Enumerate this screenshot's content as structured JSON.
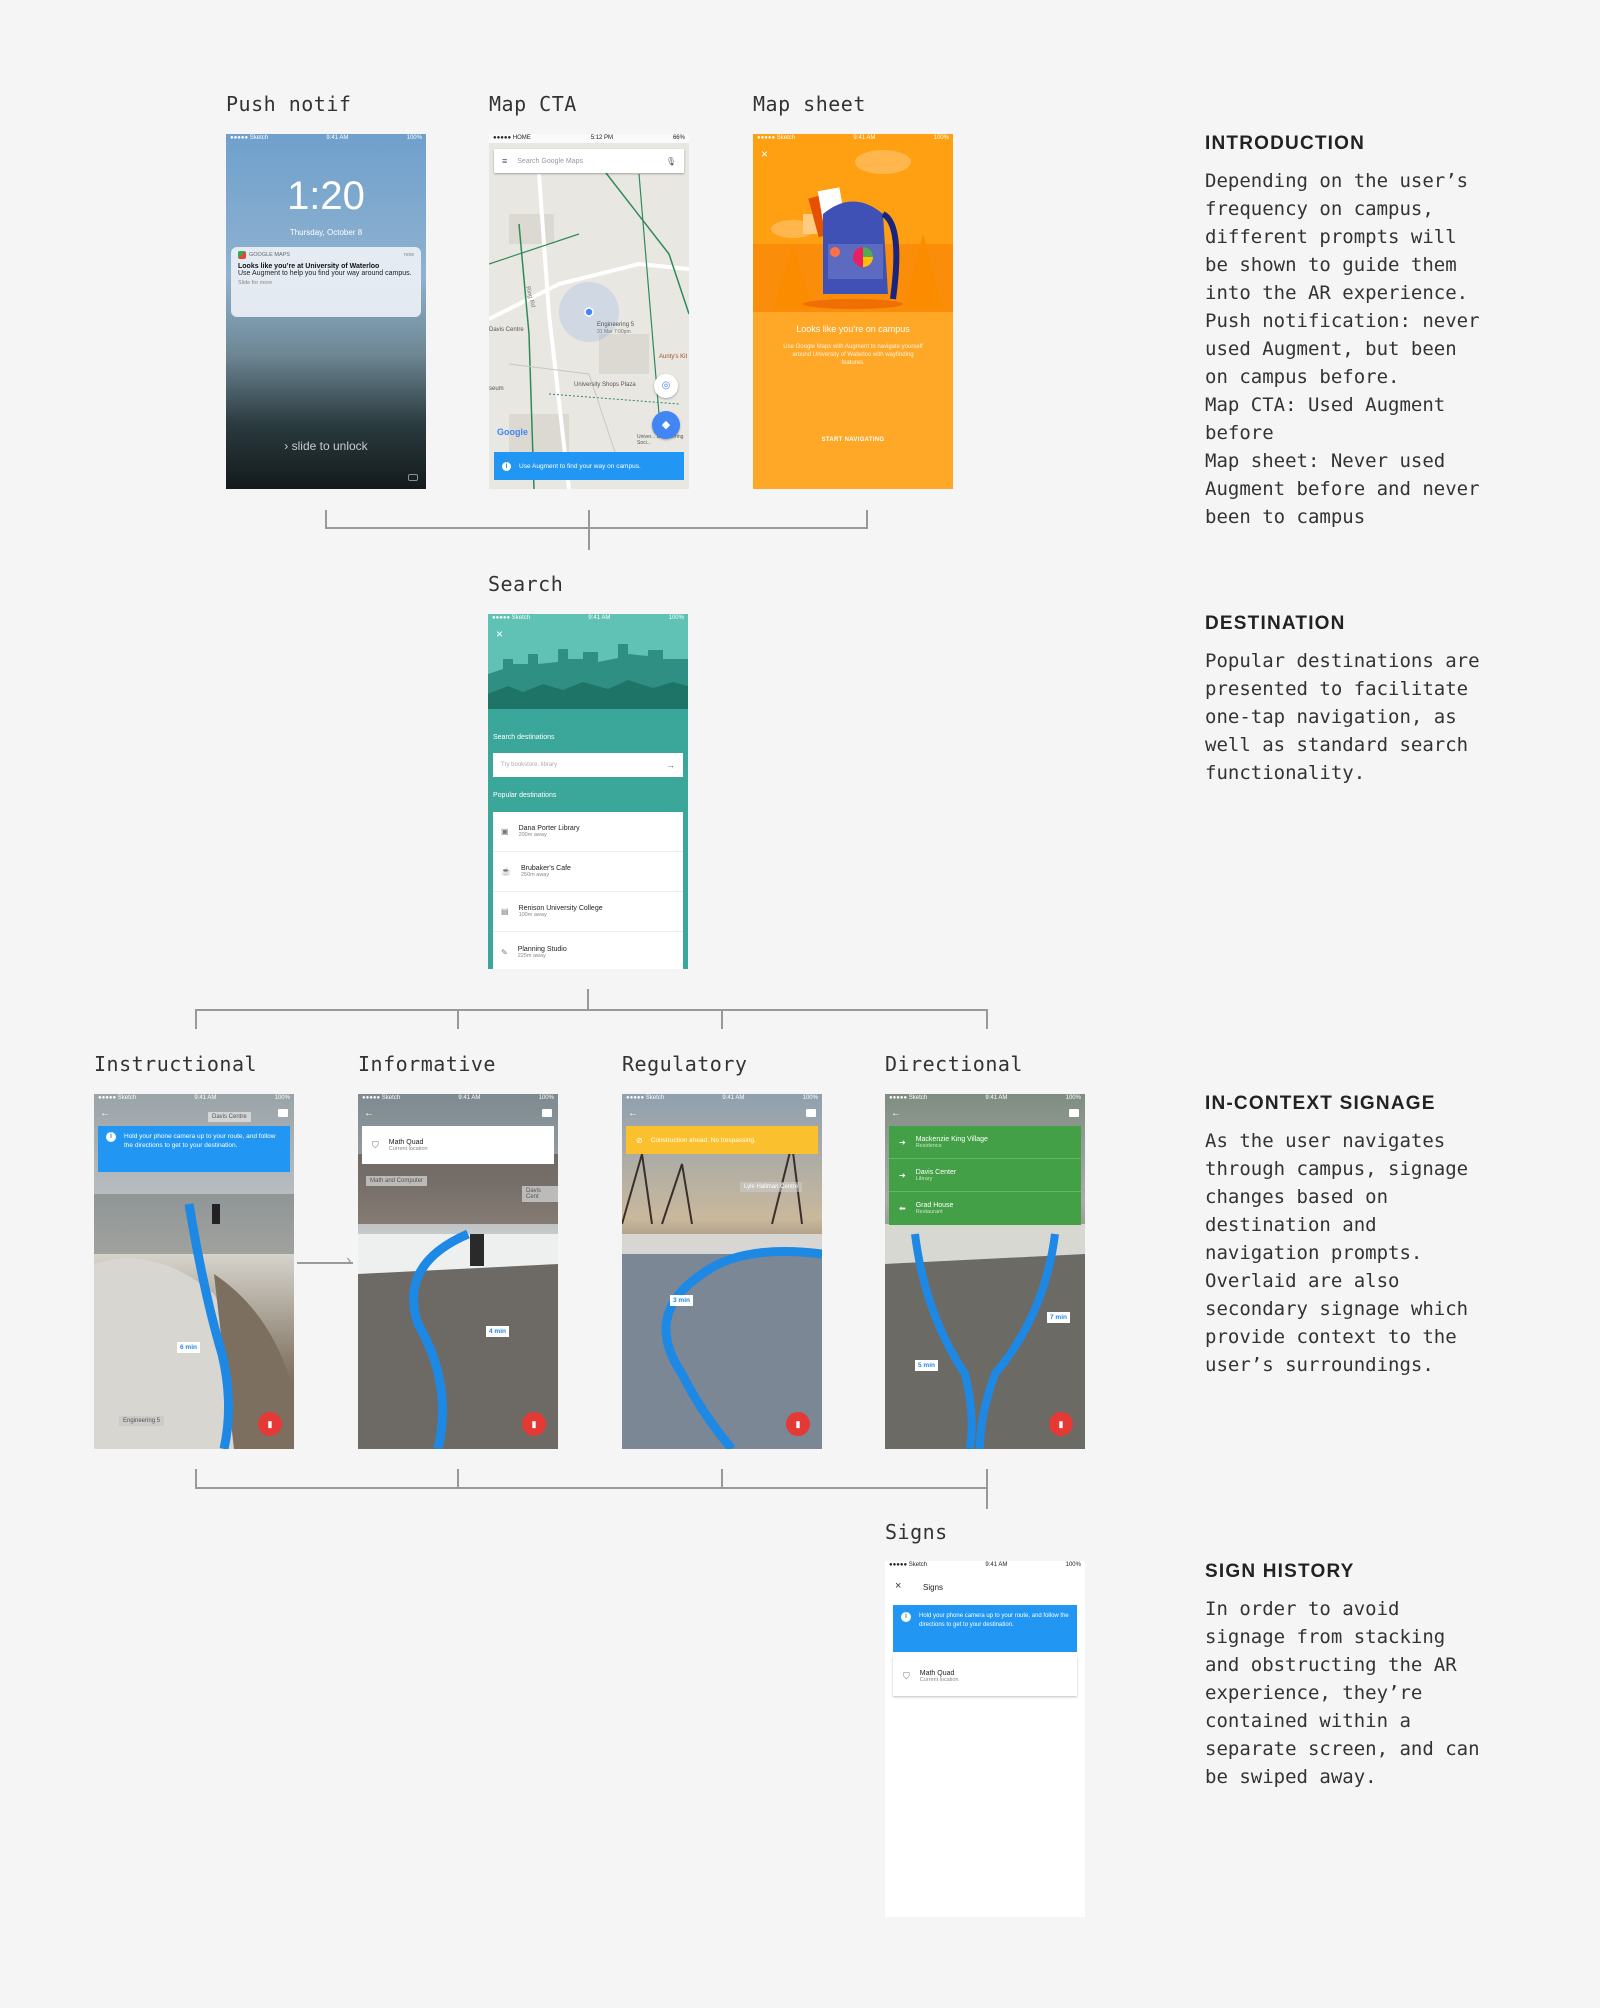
{
  "labels": {
    "push": "Push notif",
    "map_cta": "Map CTA",
    "map_sheet": "Map sheet",
    "search": "Search",
    "instructional": "Instructional",
    "informative": "Informative",
    "regulatory": "Regulatory",
    "directional": "Directional",
    "signs": "Signs"
  },
  "sections": [
    {
      "title": "INTRODUCTION",
      "body": "Depending on the user’s\nfrequency on campus,\ndifferent prompts will\nbe shown to guide them\ninto the AR experience.\nPush notification: never\nused Augment, but been\non campus before.\nMap CTA: Used Augment\nbefore\nMap sheet: Never used\nAugment before and never\nbeen to campus"
    },
    {
      "title": "DESTINATION",
      "body": "Popular destinations are\npresented to facilitate\none-tap navigation, as\nwell as standard search\nfunctionality."
    },
    {
      "title": "IN-CONTEXT SIGNAGE",
      "body": "As the user navigates\nthrough campus, signage\nchanges based on\ndestination and\nnavigation prompts.\nOverlaid are also\nsecondary signage which\nprovide context to the\nuser’s surroundings."
    },
    {
      "title": "SIGN HISTORY",
      "body": "In order to avoid\nsignage from stacking\nand obstructing the AR\nexperience, they’re\ncontained within a\nseparate screen, and can\nbe swiped away."
    }
  ],
  "lock": {
    "carrier": "●●●●● Sketch",
    "time_small": "9:41 AM",
    "battery": "100%",
    "clock": "1:20",
    "date": "Thursday, October 8",
    "app": "GOOGLE MAPS",
    "when": "now",
    "notif_title": "Looks like you’re at University of Waterloo",
    "notif_body": "Use Augment to help you find your way around campus.",
    "notif_more": "Slide for more",
    "unlock": "slide to unlock"
  },
  "map": {
    "status_left": "●●●●● HOME",
    "status_time": "5:12 PM",
    "status_right": "66%",
    "search_placeholder": "Search Google Maps",
    "place1": "Davis Centre",
    "place2": "Engineering 5",
    "place2_sub": "31 Mar 7:00pm",
    "place3": "University Shops Plaza",
    "place4": "Aunty's Kit",
    "place5": "Ring Rd",
    "place6": "seum",
    "place7": "Univer... Engineering Soci...",
    "google": "Google",
    "cta": "Use Augment to find your way on campus."
  },
  "sheet": {
    "carrier": "●●●●● Sketch",
    "time": "9:41 AM",
    "battery": "100%",
    "title": "Looks like you’re on campus",
    "body": "Use Google Maps with Augment to navigate yourself around University of Waterloo with wayfinding features.",
    "button": "START NAVIGATING"
  },
  "search": {
    "carrier": "●●●●● Sketch",
    "time": "9:41 AM",
    "battery": "100%",
    "heading": "Search destinations",
    "placeholder": "Try bookstore, library",
    "popular": "Popular destinations",
    "items": [
      {
        "name": "Dana Porter Library",
        "dist": "200m away"
      },
      {
        "name": "Brubaker's Cafe",
        "dist": "250m away"
      },
      {
        "name": "Renison University College",
        "dist": "100m away"
      },
      {
        "name": "Planning Studio",
        "dist": "225m away"
      }
    ]
  },
  "ar": {
    "carrier": "●●●●● Sketch",
    "time": "9:41 AM",
    "battery": "100%",
    "instructional": {
      "tag": "Davis Centre",
      "msg": "Hold your phone camera up to your route, and follow the directions to get to your destination.",
      "eta": "6 min",
      "sign": "Engineering 5"
    },
    "informative": {
      "title": "Math Quad",
      "sub": "Current location",
      "tag1": "Math and Computer",
      "tag2": "Davis Cent",
      "eta": "4 min"
    },
    "regulatory": {
      "msg": "Construction ahead. No trespassing.",
      "tag": "Lyle Hallman Centre",
      "eta": "3 min"
    },
    "directional": {
      "items": [
        {
          "name": "Mackenzie King Village",
          "sub": "Residence"
        },
        {
          "name": "Davis Center",
          "sub": "Library"
        },
        {
          "name": "Grad House",
          "sub": "Restaurant"
        }
      ],
      "eta1": "7 min",
      "eta2": "5 min"
    }
  },
  "signs": {
    "carrier": "●●●●● Sketch",
    "time": "9:41 AM",
    "battery": "100%",
    "title": "Signs",
    "msg": "Hold your phone camera up to your route, and follow the directions to get to your destination.",
    "item_title": "Math Quad",
    "item_sub": "Current location"
  }
}
